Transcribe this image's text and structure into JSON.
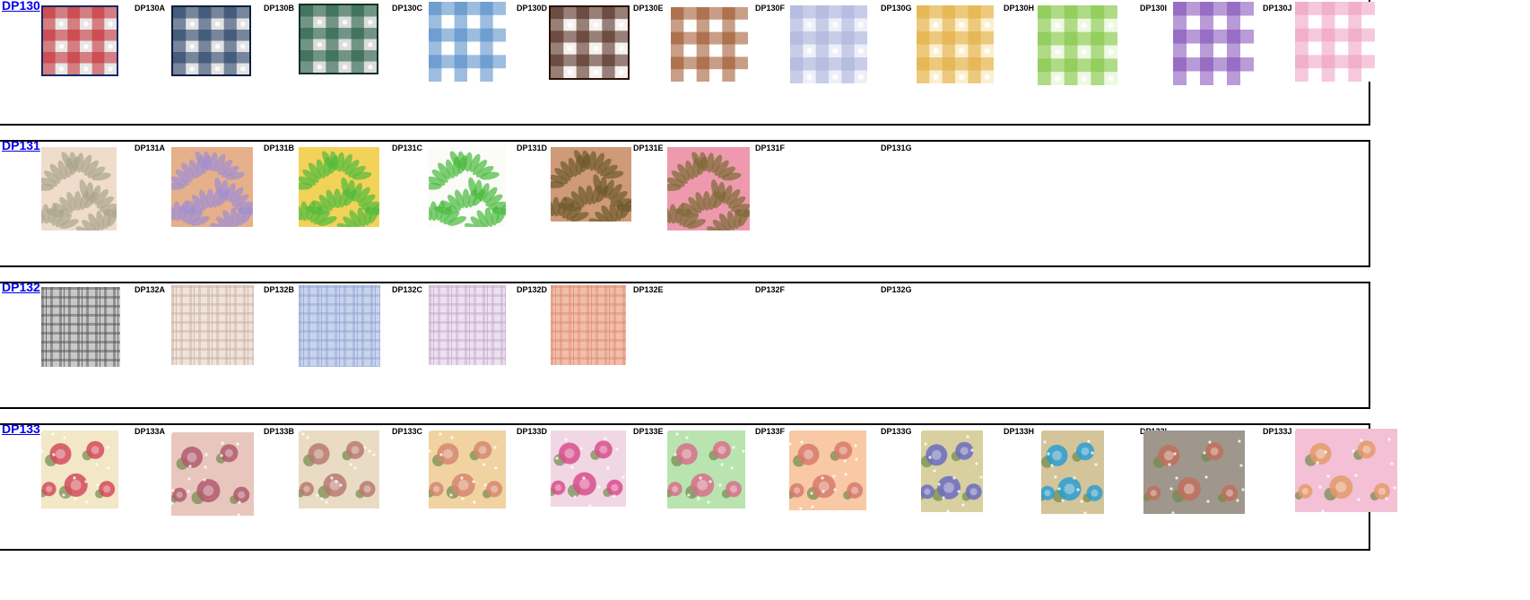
{
  "groups": [
    {
      "code": "DP130",
      "labels": [
        "DP130A",
        "DP130B",
        "DP130C",
        "DP130D",
        "DP130E",
        "DP130F",
        "DP130G",
        "DP130H",
        "DP130I",
        "DP130J"
      ],
      "swatches": [
        {
          "pattern": "gingham",
          "c1": "#c2282e",
          "c2": "#e9e6e6",
          "border": "#14286b"
        },
        {
          "pattern": "gingham",
          "c1": "#1f3a63",
          "c2": "#e2e2e2",
          "border": "#0f1f3f"
        },
        {
          "pattern": "gingham",
          "c1": "#1c5a40",
          "c2": "#dcdcdc",
          "border": "#0f3322"
        },
        {
          "pattern": "gingham",
          "c1": "#4a86c4",
          "c2": "#ffffff",
          "border": ""
        },
        {
          "pattern": "gingham",
          "c1": "#4b2216",
          "c2": "#f6f1ef",
          "border": "#2a120a"
        },
        {
          "pattern": "gingham",
          "c1": "#9b4f22",
          "c2": "#ffffff",
          "border": ""
        },
        {
          "pattern": "gingham",
          "c1": "#a7b0da",
          "c2": "#eef0f8",
          "border": ""
        },
        {
          "pattern": "gingham",
          "c1": "#e2a93a",
          "c2": "#fbefcf",
          "border": ""
        },
        {
          "pattern": "gingham",
          "c1": "#7cc23c",
          "c2": "#eef8e2",
          "border": ""
        },
        {
          "pattern": "gingham",
          "c1": "#7e48b6",
          "c2": "#ffffff",
          "border": ""
        },
        {
          "pattern": "gingham",
          "c1": "#ef9abd",
          "c2": "#ffffff",
          "border": ""
        }
      ]
    },
    {
      "code": "DP131",
      "labels": [
        "DP131A",
        "DP131B",
        "DP131C",
        "DP131D",
        "DP131E",
        "DP131F",
        "DP131G"
      ],
      "swatches": [
        {
          "pattern": "leaf",
          "c1": "#a9a58a",
          "c2": "#efdccb",
          "border": ""
        },
        {
          "pattern": "leaf",
          "c1": "#9f8fd3",
          "c2": "#e6b08a",
          "border": ""
        },
        {
          "pattern": "leaf",
          "c1": "#4fbb3d",
          "c2": "#f3d259",
          "border": ""
        },
        {
          "pattern": "leaf",
          "c1": "#47b93c",
          "c2": "#fbfbf7",
          "border": ""
        },
        {
          "pattern": "leaf",
          "c1": "#6d5a2c",
          "c2": "#cf9a78",
          "border": ""
        },
        {
          "pattern": "leaf",
          "c1": "#7b6a35",
          "c2": "#ee99ad",
          "border": ""
        }
      ]
    },
    {
      "code": "DP132",
      "labels": [
        "DP132A",
        "DP132B",
        "DP132C",
        "DP132D",
        "DP132E",
        "DP132F",
        "DP132G"
      ],
      "swatches": [
        {
          "pattern": "plaid",
          "c1": "#4e4e4e",
          "c2": "#c9c9c9",
          "border": ""
        },
        {
          "pattern": "plaid",
          "c1": "#c9ad9e",
          "c2": "#efe3db",
          "border": ""
        },
        {
          "pattern": "plaid",
          "c1": "#8fa4d4",
          "c2": "#c9d3ec",
          "border": ""
        },
        {
          "pattern": "plaid",
          "c1": "#c4a7cb",
          "c2": "#ece1ef",
          "border": ""
        },
        {
          "pattern": "plaid",
          "c1": "#de8a72",
          "c2": "#f0bea9",
          "border": ""
        }
      ]
    },
    {
      "code": "DP133",
      "labels": [
        "DP133A",
        "DP133B",
        "DP133C",
        "DP133D",
        "DP133E",
        "DP133F",
        "DP133G",
        "DP133H",
        "DP133I",
        "DP133J"
      ],
      "swatches": [
        {
          "pattern": "floral",
          "c1": "#d34b5c",
          "c2": "#f2e7c6",
          "border": ""
        },
        {
          "pattern": "floral",
          "c1": "#b05b6d",
          "c2": "#e8c6bd",
          "border": ""
        },
        {
          "pattern": "floral",
          "c1": "#b77a72",
          "c2": "#eadbc4",
          "border": ""
        },
        {
          "pattern": "floral",
          "c1": "#d5876f",
          "c2": "#f1d3a2",
          "border": ""
        },
        {
          "pattern": "floral",
          "c1": "#d84f8c",
          "c2": "#f1d7e4",
          "border": ""
        },
        {
          "pattern": "floral",
          "c1": "#d7708c",
          "c2": "#b9e4b0",
          "border": ""
        },
        {
          "pattern": "floral",
          "c1": "#d77a6c",
          "c2": "#f8c9a4",
          "border": ""
        },
        {
          "pattern": "floral",
          "c1": "#6b6cc1",
          "c2": "#d8d09e",
          "border": ""
        },
        {
          "pattern": "floral",
          "c1": "#2a9fd1",
          "c2": "#d4c49a",
          "border": ""
        },
        {
          "pattern": "floral",
          "c1": "#c0705a",
          "c2": "#9f968c",
          "border": ""
        },
        {
          "pattern": "floral",
          "c1": "#e39a6a",
          "c2": "#f3c0d5",
          "border": ""
        }
      ]
    }
  ]
}
